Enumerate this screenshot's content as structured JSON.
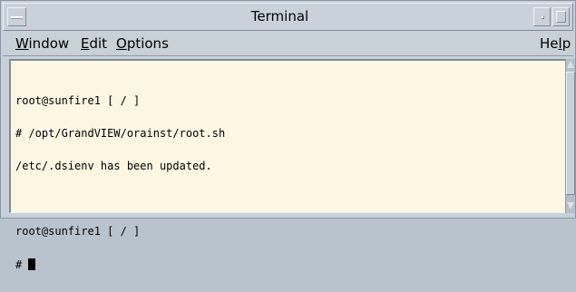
{
  "window": {
    "title": "Terminal"
  },
  "menubar": {
    "window": {
      "mnemonic": "W",
      "rest": "indow"
    },
    "edit": {
      "mnemonic": "E",
      "rest": "dit"
    },
    "options": {
      "mnemonic": "O",
      "rest": "ptions"
    },
    "help": {
      "prefix": "He",
      "mnemonic": "l",
      "rest": "p"
    }
  },
  "terminal": {
    "lines": [
      "root@sunfire1 [ / ]",
      "# /opt/GrandVIEW/orainst/root.sh",
      "/etc/.dsienv has been updated.",
      "",
      "root@sunfire1 [ / ]"
    ],
    "prompt": "# "
  },
  "icons": {
    "window_menu": "window-menu-icon",
    "minimize": "minimize-icon",
    "maximize": "maximize-icon",
    "scroll_up": "scroll-up-arrow-icon",
    "scroll_down": "scroll-down-arrow-icon"
  },
  "colors": {
    "terminal_background": "#fdf6e3",
    "terminal_text": "#000000",
    "chrome": "#c8d0d8"
  }
}
